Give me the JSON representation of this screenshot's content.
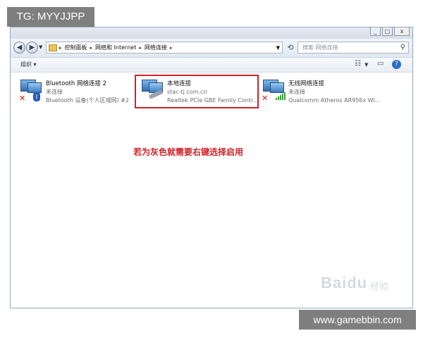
{
  "watermarks": {
    "top_left": "TG: MYYJJPP",
    "bottom_right": "www.gamebbin.com"
  },
  "window": {
    "controls": [
      "_",
      "□",
      "x"
    ]
  },
  "address_bar": {
    "breadcrumbs": [
      "控制面板",
      "网络和 Internet",
      "网络连接"
    ],
    "search_placeholder": "搜索 网络连接"
  },
  "toolbar": {
    "organize_label": "组织 ▾"
  },
  "connections": [
    {
      "name": "Bluetooth 网络连接 2",
      "status": "未连接",
      "device": "Bluetooth 设备(个人区域网) #2",
      "icon": "bluetooth-adapter-icon"
    },
    {
      "name": "本地连接",
      "status": "stac-tj.com.cn",
      "device": "Realtek PCIe GBE Family Contr...",
      "icon": "ethernet-adapter-icon"
    },
    {
      "name": "无线网络连接",
      "status": "未连接",
      "device": "Qualcomm Atheros AR956x Wi...",
      "icon": "wireless-adapter-icon"
    }
  ],
  "annotation": {
    "note": "若为灰色就需要右键选择启用",
    "color": "#d0232a"
  },
  "brand_watermark": {
    "baidu": "Baidu",
    "jingyan": "经验"
  }
}
